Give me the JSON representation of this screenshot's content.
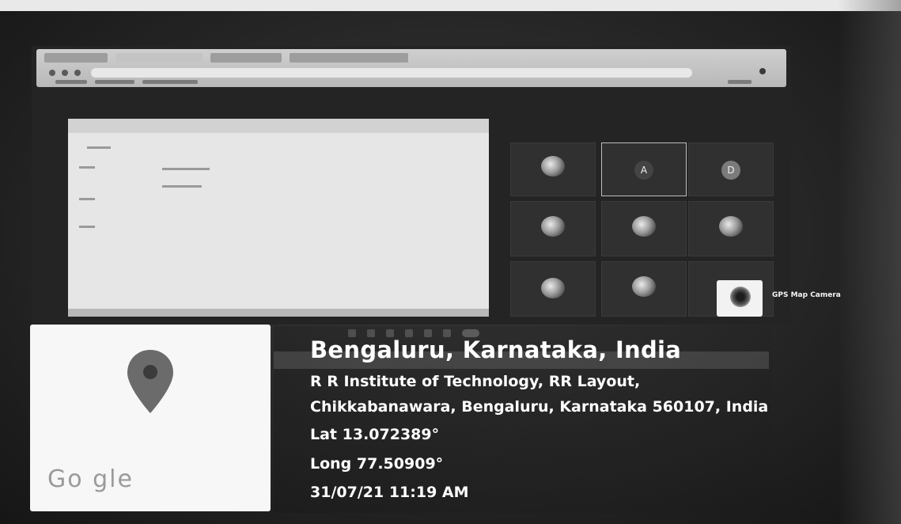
{
  "meeting": {
    "share_banner": "",
    "participants": [
      {
        "name": "",
        "avatar": "globe"
      },
      {
        "name": "",
        "avatar": "letter",
        "letter": "A",
        "selected": true
      },
      {
        "name": "",
        "avatar": "letter",
        "letter": "D"
      },
      {
        "name": "",
        "avatar": "globe"
      },
      {
        "name": "",
        "avatar": "globe"
      },
      {
        "name": "",
        "avatar": "globe"
      },
      {
        "name": "",
        "avatar": "globe"
      },
      {
        "name": "",
        "avatar": "globe"
      },
      {
        "name": "",
        "avatar": "none"
      }
    ]
  },
  "gps_app": {
    "label": "GPS Map Camera"
  },
  "map_card": {
    "brand": "Go  gle",
    "pin_color": "#6b6b6b"
  },
  "location": {
    "title": "Bengaluru, Karnataka, India",
    "address_line1": "R R Institute of Technology, RR Layout,",
    "address_line2": "Chikkabanawara, Bengaluru, Karnataka 560107, India",
    "lat": "Lat 13.072389°",
    "long": "Long 77.50909°",
    "datetime": "31/07/21 11:19 AM"
  }
}
